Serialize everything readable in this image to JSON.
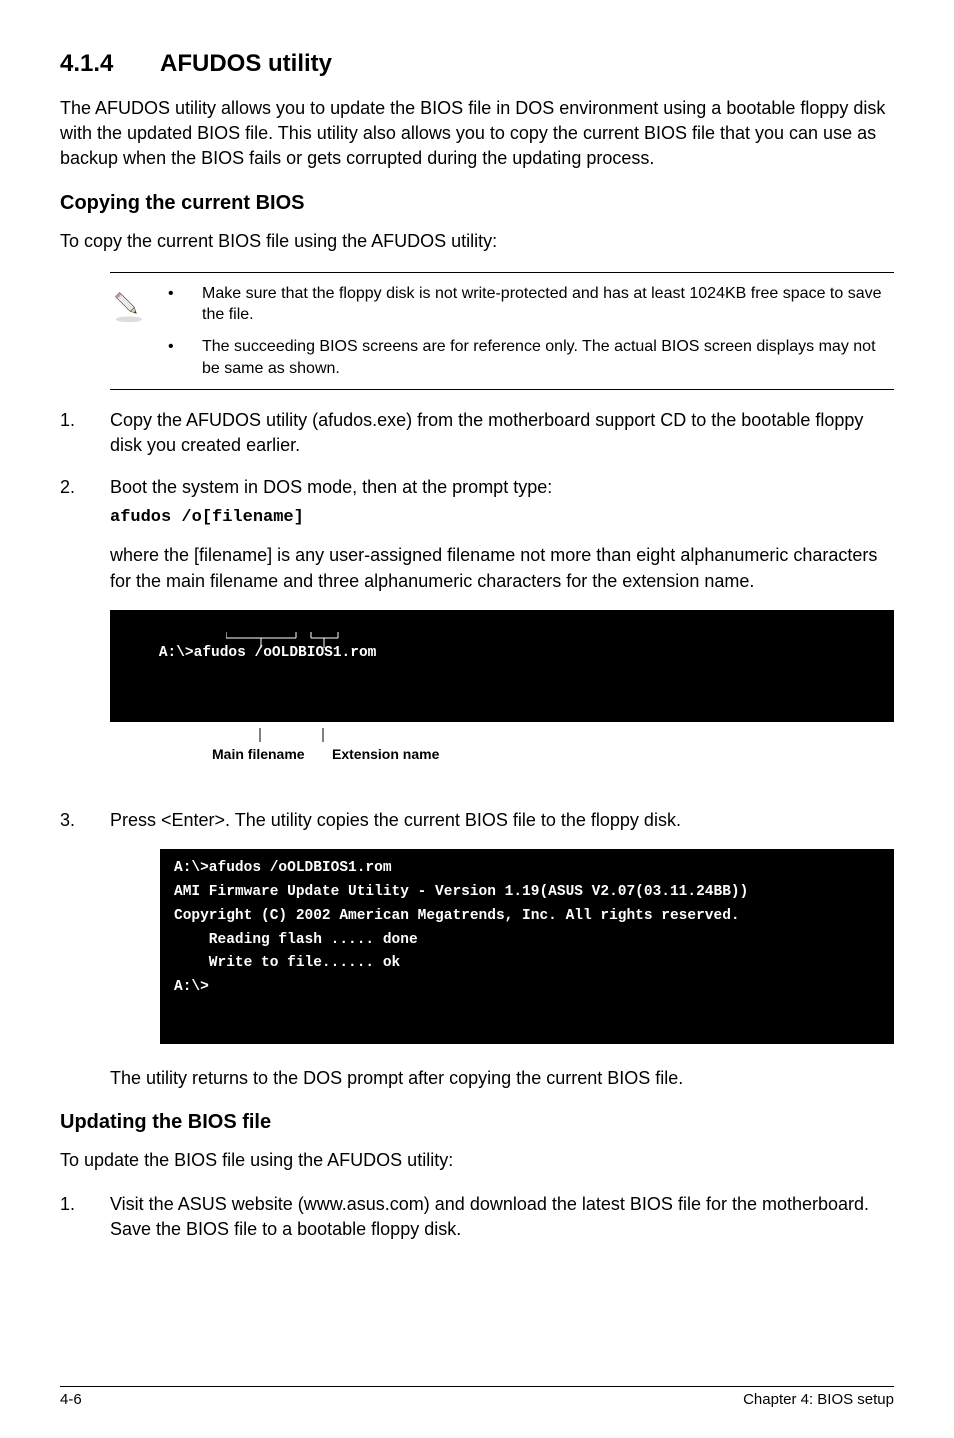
{
  "section": {
    "number": "4.1.4",
    "title": "AFUDOS utility"
  },
  "intro": "The AFUDOS utility allows you to update the BIOS file in DOS environment using a bootable floppy disk with the updated BIOS file. This utility also allows you to copy the current BIOS file that you can use as backup when the BIOS fails or gets corrupted during the updating process.",
  "copy": {
    "heading": "Copying the current BIOS",
    "lead": "To copy the current BIOS file using the AFUDOS utility:",
    "notes": [
      "Make sure that the floppy disk is not write-protected and has at least 1024KB free space to save the file.",
      "The succeeding BIOS screens are for reference only. The actual BIOS screen displays may not be same as shown."
    ],
    "step1": "Copy the AFUDOS utility (afudos.exe) from the motherboard support CD to the bootable floppy disk you created earlier.",
    "step2a": "Boot the system in DOS mode, then at the prompt type:",
    "step2cmd": "afudos /o[filename]",
    "step2b": "where the [filename] is any user-assigned filename not more than eight alphanumeric characters  for the main filename and three alphanumeric characters for the extension name.",
    "term1": "A:\\>afudos /oOLDBIOS1.rom",
    "annot_main": "Main filename",
    "annot_ext": "Extension name",
    "step3": "Press <Enter>. The utility copies the current BIOS file to the floppy disk.",
    "term2": "A:\\>afudos /oOLDBIOS1.rom\nAMI Firmware Update Utility - Version 1.19(ASUS V2.07(03.11.24BB))\nCopyright (C) 2002 American Megatrends, Inc. All rights reserved.\n    Reading flash ..... done\n    Write to file...... ok\nA:\\>\n ",
    "after": "The utility returns to the DOS prompt after copying the current BIOS file."
  },
  "update": {
    "heading": "Updating the BIOS file",
    "lead": "To update the BIOS file using the AFUDOS utility:",
    "step1": "Visit the ASUS website (www.asus.com) and download the latest BIOS file for the motherboard. Save the BIOS file to a bootable floppy disk."
  },
  "footer": {
    "left": "4-6",
    "right": "Chapter 4: BIOS setup"
  }
}
